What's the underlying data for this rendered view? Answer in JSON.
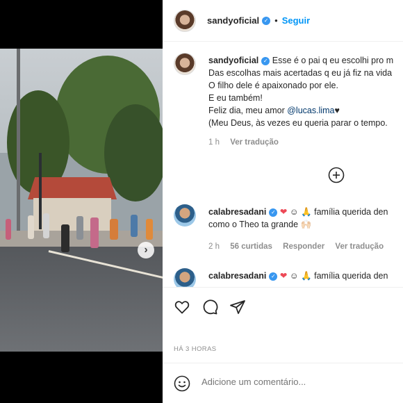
{
  "post": {
    "username": "sandyoficial",
    "follow_label": "Seguir",
    "dot": "•"
  },
  "caption": {
    "username": "sandyoficial",
    "lines": [
      "Esse é o pai q eu escolhi pro m",
      "Das escolhas mais acertadas q eu já fiz na vida",
      "O filho dele é apaixonado por ele.",
      "E eu também!",
      "Feliz dia, meu amor ",
      "(Meu Deus, às vezes eu queria parar o tempo."
    ],
    "mention": "@lucas.lima",
    "heart": "♥",
    "time": "1 h",
    "translate": "Ver tradução"
  },
  "comments": [
    {
      "username": "calabresadani",
      "text_line1": " ☺ 🙏 família querida den",
      "text_line2": "como o Theo ta grande ",
      "emoji_heart": "❤",
      "tail_emojis": "🙌🏻",
      "time": "2 h",
      "likes": "56 curtidas",
      "reply": "Responder",
      "translate": "Ver tradução"
    },
    {
      "username": "calabresadani",
      "text_line1": " ☺ 🙏 família querida den",
      "emoji_heart": "❤"
    }
  ],
  "footer": {
    "timestamp": "HÁ 3 HORAS",
    "comment_placeholder": "Adicione um comentário..."
  },
  "icons": {
    "like": "heart-icon",
    "comment": "comment-icon",
    "share": "share-icon",
    "emoji": "smile-icon",
    "more_comments": "plus-circle-icon",
    "next": "chevron-right-icon"
  },
  "colors": {
    "link": "#0095f6",
    "verified": "#3897f0",
    "meta": "#8e8e8e",
    "mention": "#00376b"
  }
}
